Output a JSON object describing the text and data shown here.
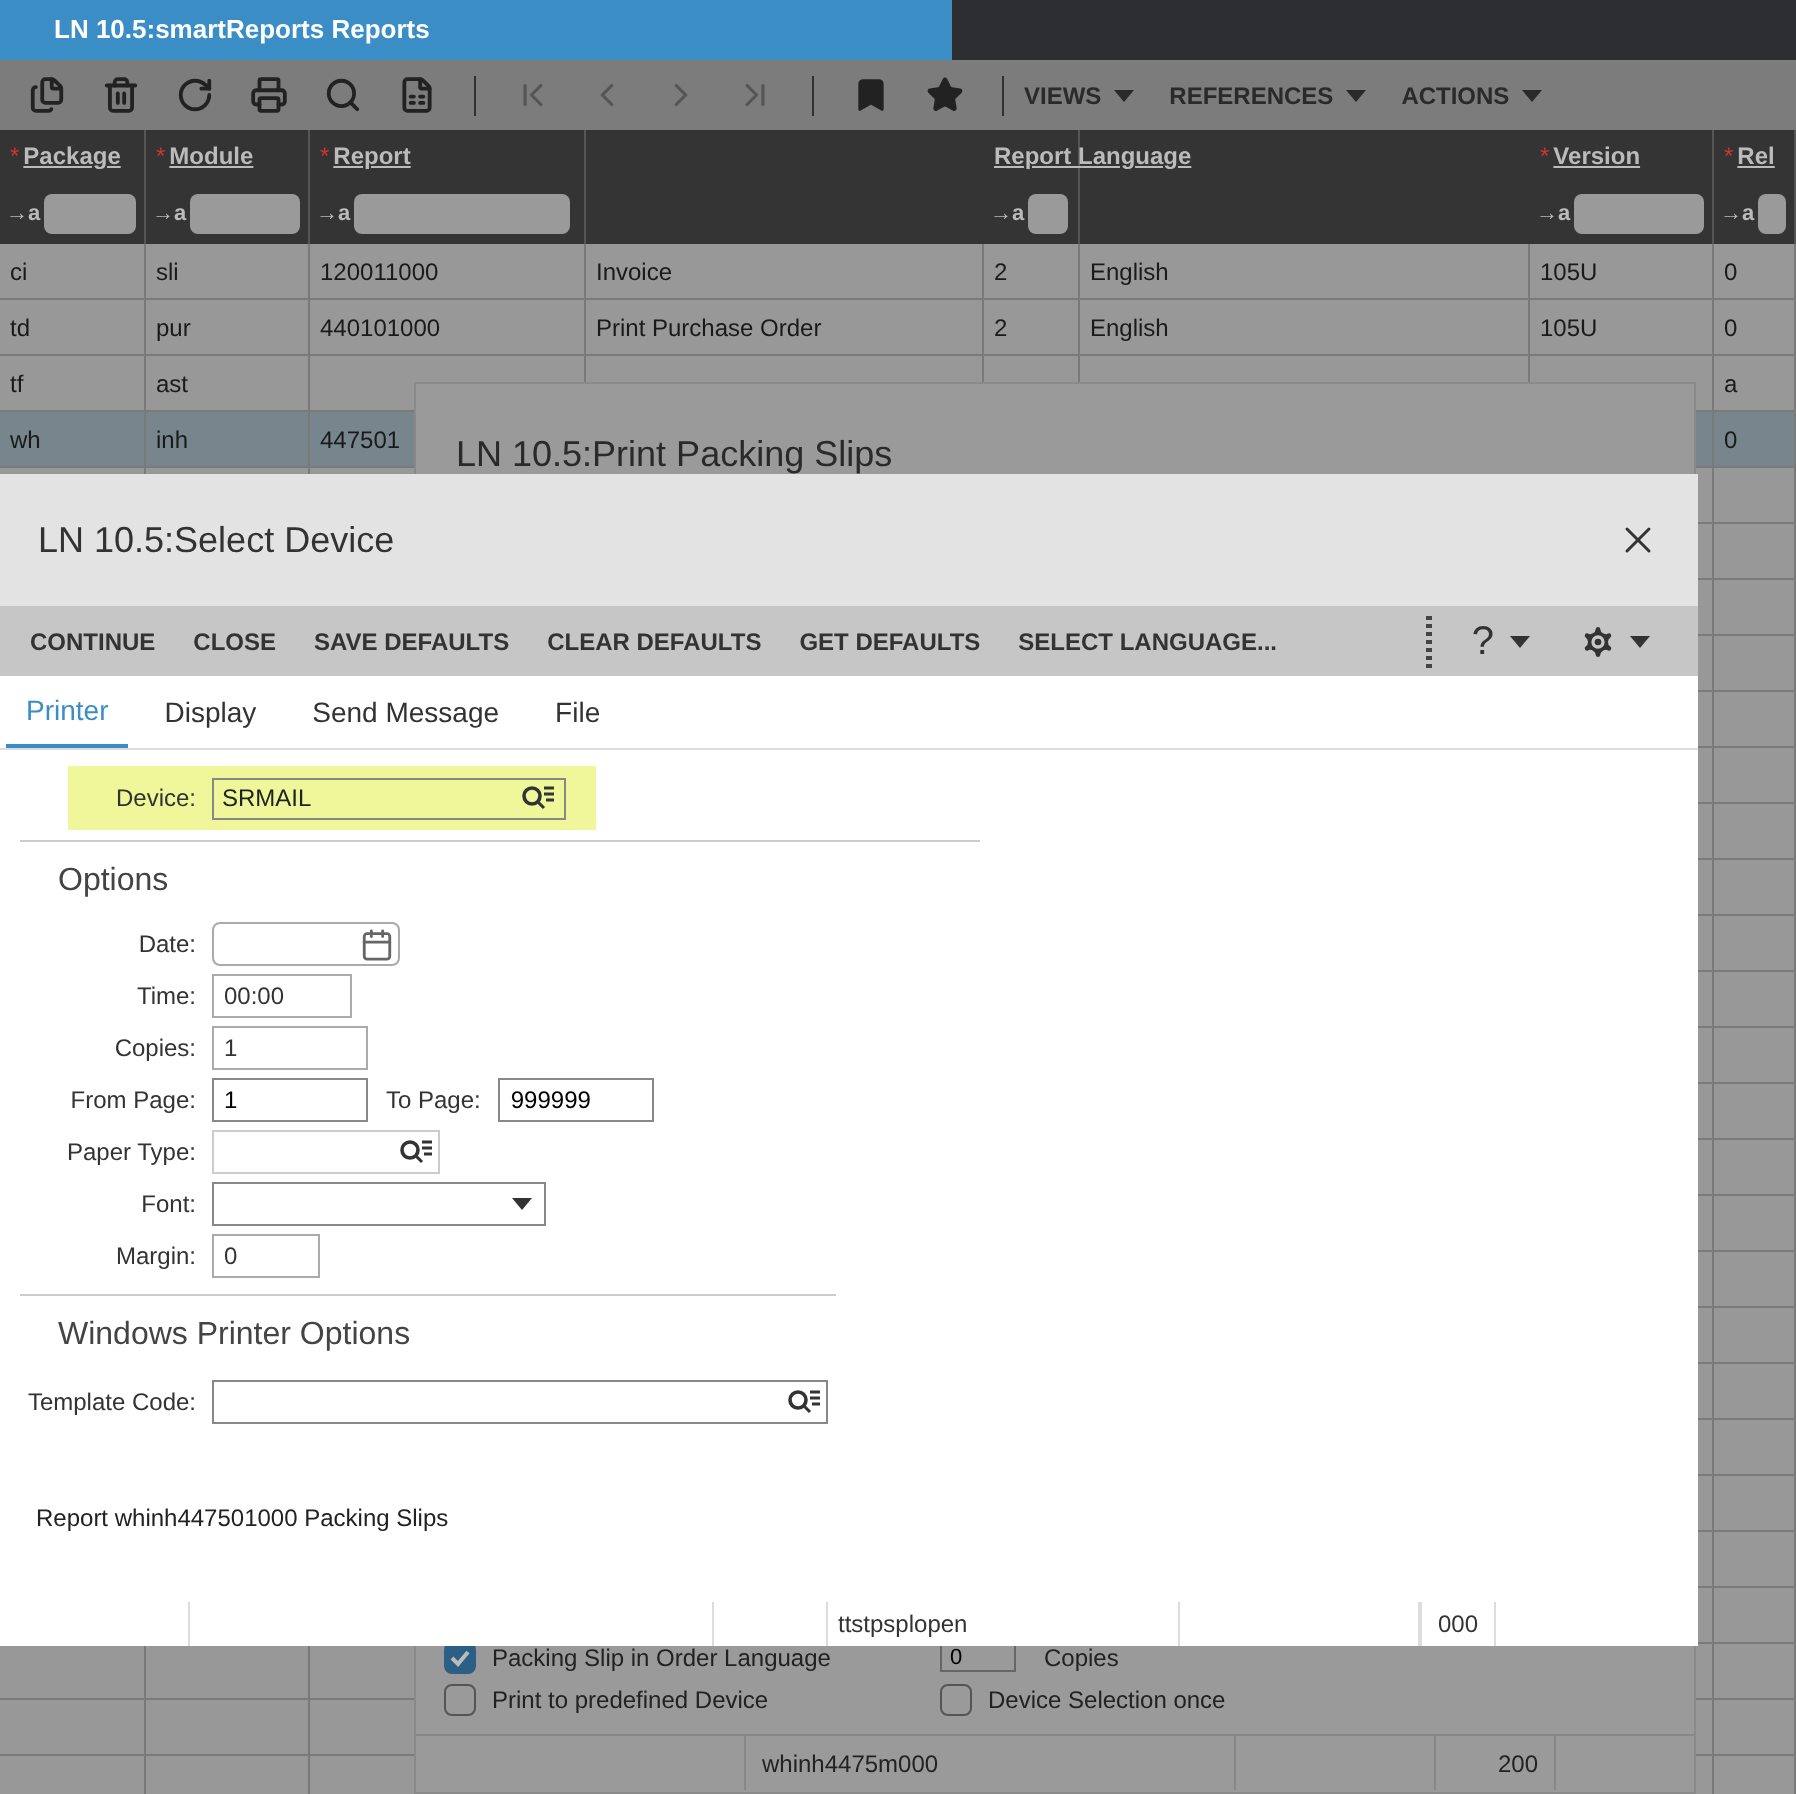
{
  "app": {
    "title": "LN 10.5:smartReports Reports",
    "menus": [
      "VIEWS",
      "REFERENCES",
      "ACTIONS"
    ],
    "columns": [
      {
        "marker": "*",
        "label": "Package",
        "filter": "→a"
      },
      {
        "marker": "*",
        "label": "Module",
        "filter": "→a"
      },
      {
        "marker": "*",
        "label": "Report",
        "filter": "→a"
      },
      {},
      {
        "label": "Report Language",
        "filter": "→a"
      },
      {},
      {
        "marker": "*",
        "label": "Version",
        "filter": "→a"
      },
      {
        "marker": "*",
        "label": "Rel",
        "filter": "→a"
      }
    ],
    "rows": [
      {
        "cells": [
          "ci",
          "sli",
          "120011000",
          "Invoice",
          "2",
          "English",
          "105U",
          "0"
        ],
        "selected": false
      },
      {
        "cells": [
          "td",
          "pur",
          "440101000",
          "Print Purchase Order",
          "2",
          "English",
          "105U",
          "0"
        ],
        "selected": false
      },
      {
        "cells": [
          "tf",
          "ast",
          "",
          "",
          "",
          "",
          "",
          "a"
        ],
        "selected": false
      },
      {
        "cells": [
          "wh",
          "inh",
          "447501",
          "",
          "",
          "",
          "",
          "0"
        ],
        "selected": true
      }
    ]
  },
  "back_dialog": {
    "title": "LN 10.5:Print Packing Slips",
    "strip_cells": [
      "ttstpsplopen",
      "000"
    ],
    "options": [
      {
        "label": "Packing Slip in Order Language",
        "checked": true
      },
      {
        "label": "Print to predefined Device",
        "checked": false
      },
      {
        "label": "Device Selection once",
        "checked": false
      }
    ],
    "copies_value": "0",
    "copies_label": "Copies",
    "bottom_cells": [
      "whinh4475m000",
      "200"
    ]
  },
  "dialog": {
    "title": "LN 10.5:Select Device",
    "actions": [
      "CONTINUE",
      "CLOSE",
      "SAVE DEFAULTS",
      "CLEAR DEFAULTS",
      "GET DEFAULTS",
      "SELECT LANGUAGE..."
    ],
    "help": "?",
    "tabs": [
      {
        "label": "Printer",
        "selected": true
      },
      {
        "label": "Display",
        "selected": false
      },
      {
        "label": "Send Message",
        "selected": false
      },
      {
        "label": "File",
        "selected": false
      }
    ],
    "device": {
      "label": "Device:",
      "value": "SRMAIL"
    },
    "options_title": "Options",
    "fields": [
      {
        "label": "Date:",
        "kind": "date"
      },
      {
        "label": "Time:",
        "value": "00:00",
        "kind": "text"
      },
      {
        "label": "Copies:",
        "value": "1",
        "kind": "text"
      },
      {
        "label": "From Page:",
        "value": "1",
        "kind": "range",
        "to_label": "To Page:",
        "to_value": "999999"
      },
      {
        "label": "Paper Type:",
        "kind": "lookup"
      },
      {
        "label": "Font:",
        "kind": "select"
      },
      {
        "label": "Margin:",
        "value": "0",
        "kind": "text"
      }
    ],
    "windows_title": "Windows Printer Options",
    "template": {
      "label": "Template Code:"
    },
    "footer": "Report whinh447501000 Packing Slips"
  }
}
